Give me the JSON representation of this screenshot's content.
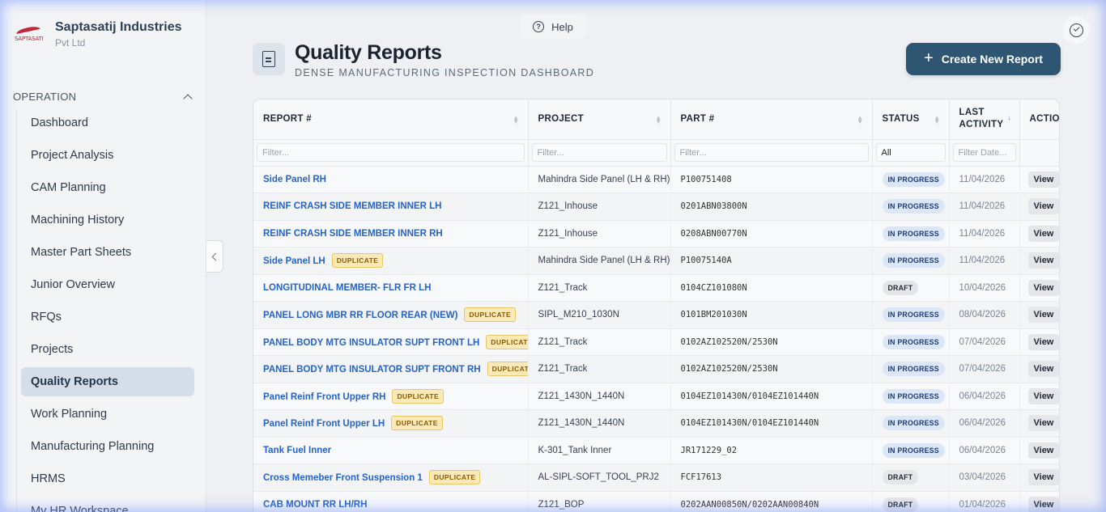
{
  "brand": {
    "name": "Saptasatij Industries",
    "sub": "Pvt Ltd",
    "logo_text": "SAPTASATI"
  },
  "sidebar": {
    "section": "OPERATION",
    "items": [
      {
        "label": "Dashboard"
      },
      {
        "label": "Project Analysis"
      },
      {
        "label": "CAM Planning"
      },
      {
        "label": "Machining History"
      },
      {
        "label": "Master Part Sheets"
      },
      {
        "label": "Junior Overview"
      },
      {
        "label": "RFQs"
      },
      {
        "label": "Projects"
      },
      {
        "label": "Quality Reports",
        "active": true
      },
      {
        "label": "Work Planning"
      },
      {
        "label": "Manufacturing Planning"
      },
      {
        "label": "HRMS"
      },
      {
        "label": "My HR Workspace"
      }
    ]
  },
  "help": {
    "label": "Help"
  },
  "header": {
    "title": "Quality Reports",
    "subtitle": "DENSE MANUFACTURING INSPECTION DASHBOARD",
    "create_label": "Create New Report"
  },
  "table": {
    "columns": [
      "REPORT #",
      "PROJECT",
      "PART #",
      "STATUS",
      "LAST ACTIVITY",
      "ACTION"
    ],
    "filters": {
      "placeholder": "Filter...",
      "status_value": "All",
      "date_placeholder": "Filter Date..."
    },
    "view_label": "View",
    "duplicate_label": "DUPLICATE",
    "rows": [
      {
        "report": "Side Panel RH",
        "dup": false,
        "project": "Mahindra Side Panel (LH & RH)",
        "part": "P100751408",
        "status": "IN PROGRESS",
        "date": "11/04/2026"
      },
      {
        "report": "REINF CRASH SIDE MEMBER INNER LH",
        "dup": false,
        "project": "Z121_Inhouse",
        "part": "0201ABN03800N",
        "status": "IN PROGRESS",
        "date": "11/04/2026"
      },
      {
        "report": "REINF CRASH SIDE MEMBER INNER RH",
        "dup": false,
        "project": "Z121_Inhouse",
        "part": "0208ABN00770N",
        "status": "IN PROGRESS",
        "date": "11/04/2026"
      },
      {
        "report": "Side Panel LH",
        "dup": true,
        "project": "Mahindra Side Panel (LH & RH)",
        "part": "P10075140A",
        "status": "IN PROGRESS",
        "date": "11/04/2026"
      },
      {
        "report": "LONGITUDINAL MEMBER- FLR FR LH",
        "dup": false,
        "project": "Z121_Track",
        "part": "0104CZ101080N",
        "status": "DRAFT",
        "date": "10/04/2026"
      },
      {
        "report": "PANEL LONG MBR RR FLOOR REAR (NEW)",
        "dup": true,
        "project": "SIPL_M210_1030N",
        "part": "0101BM201030N",
        "status": "IN PROGRESS",
        "date": "08/04/2026"
      },
      {
        "report": "PANEL BODY MTG INSULATOR SUPT FRONT LH",
        "dup": true,
        "project": "Z121_Track",
        "part": "0102AZ102520N/2530N",
        "status": "IN PROGRESS",
        "date": "07/04/2026"
      },
      {
        "report": "PANEL BODY MTG INSULATOR SUPT FRONT RH",
        "dup": true,
        "project": "Z121_Track",
        "part": "0102AZ102520N/2530N",
        "status": "IN PROGRESS",
        "date": "07/04/2026"
      },
      {
        "report": "Panel Reinf Front Upper RH",
        "dup": true,
        "project": "Z121_1430N_1440N",
        "part": "0104EZ101430N/0104EZ101440N",
        "status": "IN PROGRESS",
        "date": "06/04/2026"
      },
      {
        "report": "Panel Reinf Front Upper LH",
        "dup": true,
        "project": "Z121_1430N_1440N",
        "part": "0104EZ101430N/0104EZ101440N",
        "status": "IN PROGRESS",
        "date": "06/04/2026"
      },
      {
        "report": "Tank Fuel Inner",
        "dup": false,
        "project": "K-301_Tank Inner",
        "part": "JR171229_02",
        "status": "IN PROGRESS",
        "date": "06/04/2026"
      },
      {
        "report": "Cross Memeber Front Suspension 1",
        "dup": true,
        "project": "AL-SIPL-SOFT_TOOL_PRJ2",
        "part": "FCF17613",
        "status": "DRAFT",
        "date": "03/04/2026"
      },
      {
        "report": "CAB MOUNT RR LH/RH",
        "dup": false,
        "project": "Z121_BOP",
        "part": "0202AAN00850N/0202AAN00840N",
        "status": "DRAFT",
        "date": "01/04/2026"
      }
    ]
  },
  "colors": {
    "accent": "#2e5672",
    "link": "#2563c9",
    "active_nav": "#d5dee8"
  }
}
